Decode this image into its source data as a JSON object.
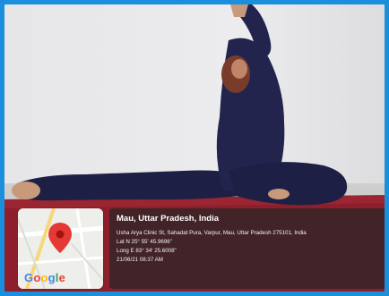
{
  "geotag": {
    "location_title": "Mau, Uttar Pradesh, India",
    "address": "Usha Arya Clinic St, Sahadat Pura, Varpur, Mau, Uttar Pradesh 275101, India",
    "latitude": "Lat N 25° 55' 45.9696\"",
    "longitude": "Long E 83° 34' 25.6008\"",
    "datetime": "21/06/21 08:37 AM",
    "map_brand": "Google",
    "pin_icon": "map-pin-icon"
  },
  "colors": {
    "frame_border": "#1a8fdc",
    "wall": "#e9e9ea",
    "clothing": "#1e1f45",
    "mat": "#8e1f2c",
    "pin": "#e53935"
  }
}
